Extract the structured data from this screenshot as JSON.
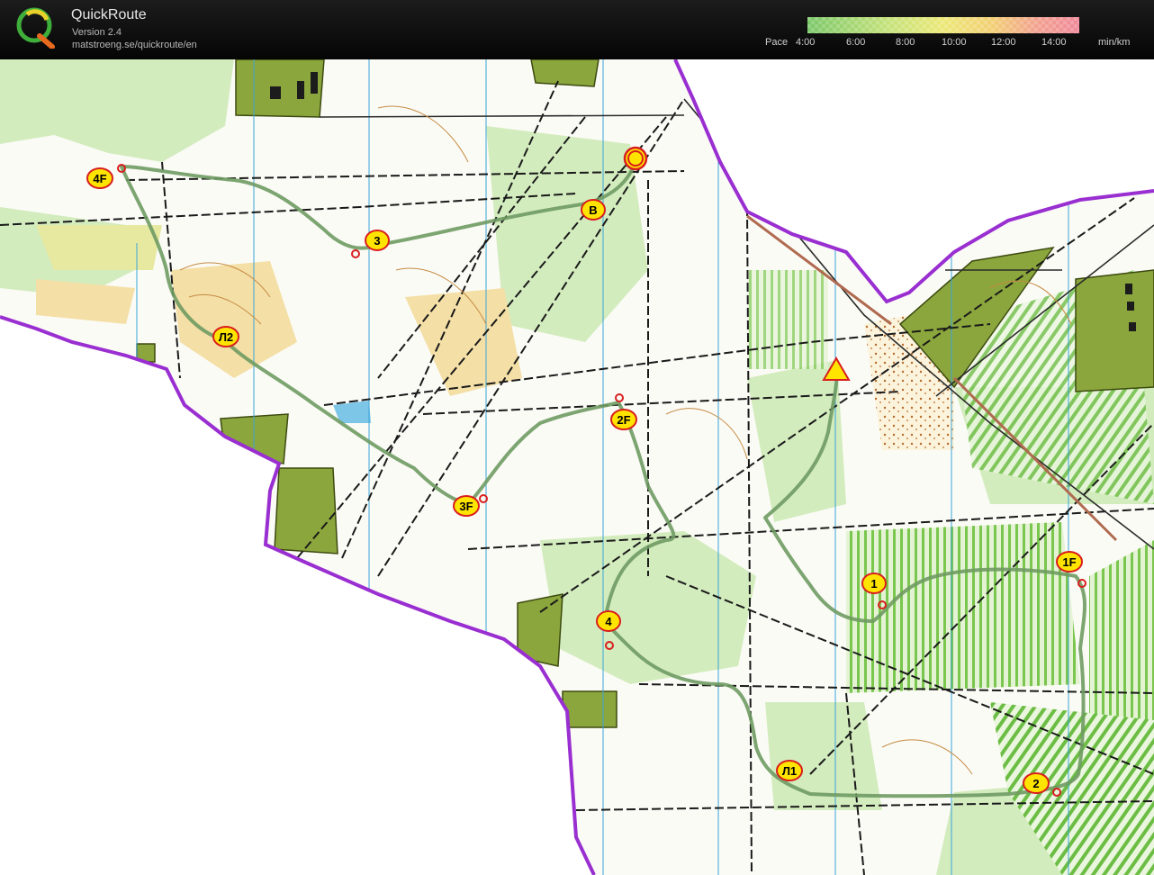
{
  "app": {
    "title": "QuickRoute",
    "version": "Version 2.4",
    "url": "matstroeng.se/quickroute/en",
    "logo_letter": "Q"
  },
  "pace_legend": {
    "label": "Pace",
    "ticks": [
      "4:00",
      "6:00",
      "8:00",
      "10:00",
      "12:00",
      "14:00"
    ],
    "unit": "min/km",
    "colors": [
      "#6fc45a",
      "#b4dc5e",
      "#e8e860",
      "#f2c65e",
      "#f08c7a",
      "#ee6a82"
    ]
  },
  "map": {
    "colors": {
      "route": "#6f9b63",
      "boundary": "#9a2fd1",
      "control": "#d81e1e",
      "label_fill": "#ffe400",
      "forest": "#8ba63c",
      "open_land": "#c5e6a2"
    },
    "controls": [
      {
        "label": "4F"
      },
      {
        "label": "3"
      },
      {
        "label": "B"
      },
      {
        "label": "Л2"
      },
      {
        "label": "2F"
      },
      {
        "label": "3F"
      },
      {
        "label": "1"
      },
      {
        "label": "1F"
      },
      {
        "label": "4"
      },
      {
        "label": "Л1"
      },
      {
        "label": "2"
      }
    ]
  }
}
